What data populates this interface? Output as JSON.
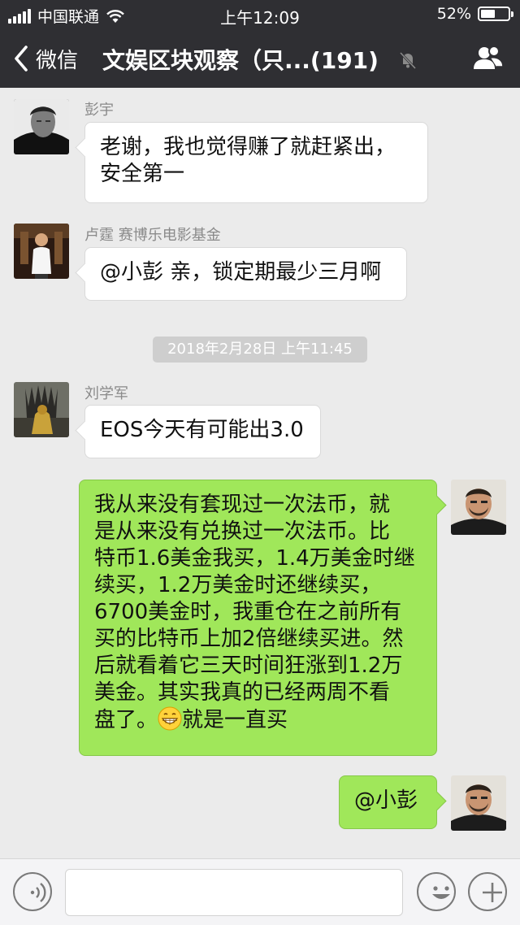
{
  "status_bar": {
    "carrier": "中国联通",
    "time": "上午12:09",
    "battery": "52%",
    "battery_level": 0.52
  },
  "nav": {
    "back_label": "微信",
    "title": "文娱区块观察（只...(191)"
  },
  "messages": [
    {
      "sender": "彭宇",
      "text": "老谢，我也觉得赚了就赶紧出，\n安全第一"
    },
    {
      "sender": "卢霆 赛博乐电影基金",
      "text": "@小彭 亲，锁定期最少三月啊"
    },
    {
      "timestamp": "2018年2月28日 上午11:45"
    },
    {
      "sender": "刘学军",
      "text": "EOS今天有可能出3.0"
    },
    {
      "text_before_emoji": "我从来没有套现过一次法币，就\n是从来没有兑换过一次法币。比\n特币1.6美金我买，1.4万美金时继\n续买，1.2万美金时还继续买，\n6700美金时，我重仓在之前所有\n买的比特币上加2倍继续买进。然\n后就看着它三天时间狂涨到1.2万\n美金。其实我真的已经两周不看\n盘了。",
      "emoji": "grinning-face",
      "text_after_emoji": "就是一直买"
    },
    {
      "text": "@小彭"
    }
  ],
  "colors": {
    "header_bg": "#2f2f33",
    "chat_bg": "#ebebeb",
    "outgoing_bubble": "#a0e75a",
    "incoming_bubble": "#ffffff"
  },
  "icons": [
    "wifi-icon",
    "back-chevron-icon",
    "mute-bell-icon",
    "contacts-icon",
    "voice-icon",
    "emoji-icon",
    "plus-icon"
  ]
}
